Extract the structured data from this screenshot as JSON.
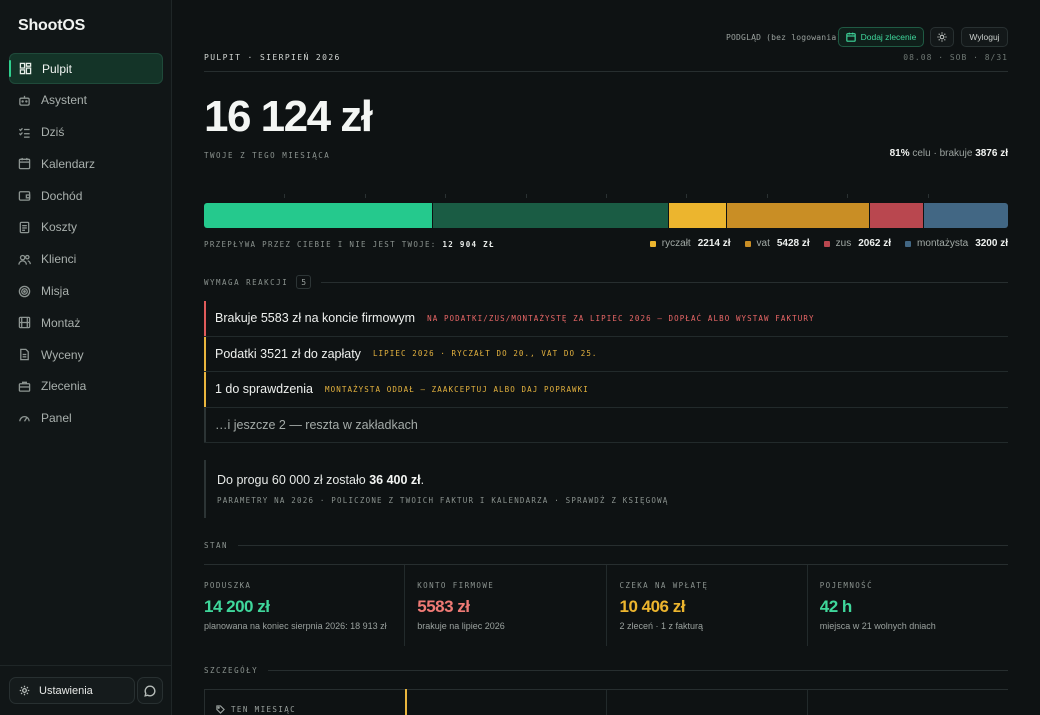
{
  "app": {
    "name": "ShootOS"
  },
  "sidebar": {
    "items": [
      {
        "label": "Pulpit",
        "icon": "dashboard-icon",
        "active": true
      },
      {
        "label": "Asystent",
        "icon": "robot-icon"
      },
      {
        "label": "Dziś",
        "icon": "checklist-icon"
      },
      {
        "label": "Kalendarz",
        "icon": "calendar-icon"
      },
      {
        "label": "Dochód",
        "icon": "wallet-icon"
      },
      {
        "label": "Koszty",
        "icon": "receipt-icon"
      },
      {
        "label": "Klienci",
        "icon": "users-icon"
      },
      {
        "label": "Misja",
        "icon": "target-icon"
      },
      {
        "label": "Montaż",
        "icon": "film-icon"
      },
      {
        "label": "Wyceny",
        "icon": "document-icon"
      },
      {
        "label": "Zlecenia",
        "icon": "briefcase-icon"
      },
      {
        "label": "Panel",
        "icon": "gauge-icon"
      }
    ],
    "settings_label": "Ustawienia"
  },
  "topbar": {
    "preview_label": "PODGLĄD (bez logowania)",
    "add_order_label": "Dodaj zlecenie",
    "logout_label": "Wyloguj"
  },
  "header": {
    "crumb": "PULPIT · SIERPIEŃ 2026",
    "date": "08.08 · SOB · 8/31"
  },
  "summary": {
    "amount": "16 124 zł",
    "amount_label": "TWOJE Z TEGO MIESIĄCA",
    "goal_pct": "81%",
    "goal_text": "celu · brakuje",
    "goal_missing": "3876 zł",
    "flow_label": "PRZEPŁYWA PRZEZ CIEBIE I NIE JEST TWOJE:",
    "flow_value": "12 904 ZŁ"
  },
  "breakdown": {
    "segments": [
      {
        "name": "twoje",
        "value": 8700,
        "color": "#25c98d"
      },
      {
        "name": "twoje-rezerwa",
        "value": 9000,
        "color": "#1a5c44"
      },
      {
        "name": "ryczałt",
        "value": 2214,
        "color": "#ecb52e"
      },
      {
        "name": "vat",
        "value": 5428,
        "color": "#c98e25"
      },
      {
        "name": "zus",
        "value": 2062,
        "color": "#b9474f"
      },
      {
        "name": "montażysta",
        "value": 3200,
        "color": "#426784"
      }
    ],
    "legend": [
      {
        "label": "ryczałt",
        "value": "2214 zł",
        "color": "#ecb52e"
      },
      {
        "label": "vat",
        "value": "5428 zł",
        "color": "#c98e25"
      },
      {
        "label": "zus",
        "value": "2062 zł",
        "color": "#b9474f"
      },
      {
        "label": "montażysta",
        "value": "3200 zł",
        "color": "#426784"
      }
    ]
  },
  "attention": {
    "label": "WYMAGA REAKCJI",
    "count": "5",
    "items": [
      {
        "title": "Brakuje 5583 zł na koncie firmowym",
        "note": "NA PODATKI/ZUS/MONTAŻYSTĘ ZA LIPIEC 2026 — DOPŁAĆ ALBO WYSTAW FAKTURY",
        "tone": "red"
      },
      {
        "title": "Podatki 3521 zł do zapłaty",
        "note": "LIPIEC 2026 · RYCZAŁT DO 20., VAT DO 25.",
        "tone": "yellow"
      },
      {
        "title": "1 do sprawdzenia",
        "note": "MONTAŻYSTA ODDAŁ — ZAAKCEPTUJ ALBO DAJ POPRAWKI",
        "tone": "yellow"
      },
      {
        "title": "…i jeszcze 2 — reszta w zakładkach",
        "note": "",
        "tone": "grey"
      }
    ]
  },
  "threshold": {
    "text_prefix": "Do progu 60 000 zł zostało",
    "text_value": "36 400 zł",
    "text_suffix": ".",
    "sub": "PARAMETRY NA 2026 · POLICZONE Z TWOICH FAKTUR I KALENDARZA · SPRAWDŹ Z KSIĘGOWĄ"
  },
  "state": {
    "label": "STAN",
    "cards": [
      {
        "label": "PODUSZKA",
        "value": "14 200 zł",
        "sub": "planowana na koniec sierpnia 2026: 18 913 zł",
        "color": "#3fd79b"
      },
      {
        "label": "KONTO FIRMOWE",
        "value": "5583 zł",
        "sub": "brakuje na lipiec 2026",
        "color": "#ef7a75"
      },
      {
        "label": "CZEKA NA WPŁATĘ",
        "value": "10 406 zł",
        "sub": "2 zleceń · 1 z fakturą",
        "color": "#ecb52e"
      },
      {
        "label": "POJEMNOŚĆ",
        "value": "42 h",
        "sub": "miejsca w 21 wolnych dniach",
        "color": "#3fd79b"
      }
    ]
  },
  "details": {
    "label": "SZCZEGÓŁY",
    "first_cell": "TEN MIESIĄC"
  }
}
